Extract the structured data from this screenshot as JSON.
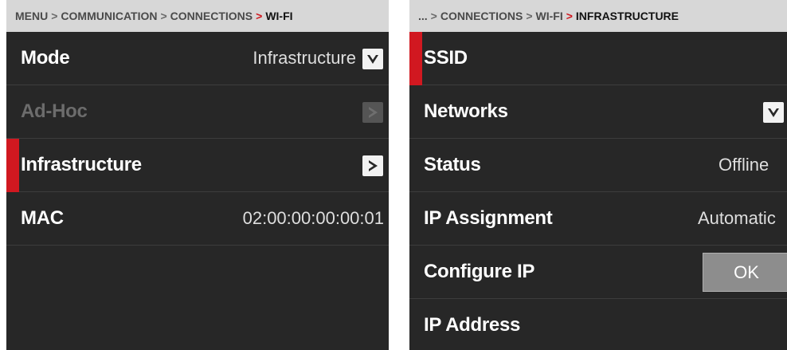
{
  "left_panel": {
    "breadcrumb": {
      "path": [
        "MENU",
        "COMMUNICATION",
        "CONNECTIONS"
      ],
      "current": "WI-FI"
    },
    "rows": {
      "mode": {
        "label": "Mode",
        "value": "Infrastructure",
        "icon": "chevron-down-icon"
      },
      "adhoc": {
        "label": "Ad-Hoc",
        "icon": "chevron-right-icon",
        "disabled": true
      },
      "infrastructure": {
        "label": "Infrastructure",
        "icon": "chevron-right-icon",
        "selected": true
      },
      "mac": {
        "label": "MAC",
        "value": "02:00:00:00:00:01"
      }
    }
  },
  "right_panel": {
    "breadcrumb": {
      "path": [
        "...",
        "CONNECTIONS",
        "WI-FI"
      ],
      "current": "INFRASTRUCTURE"
    },
    "rows": {
      "ssid": {
        "label": "SSID",
        "selected": true
      },
      "networks": {
        "label": "Networks",
        "icon": "chevron-down-icon"
      },
      "status": {
        "label": "Status",
        "value": "Offline"
      },
      "ip_assignment": {
        "label": "IP Assignment",
        "value": "Automatic"
      },
      "configure_ip": {
        "label": "Configure IP",
        "button": "OK"
      },
      "ip_address": {
        "label": "IP Address"
      }
    }
  },
  "colors": {
    "panel_bg": "#272727",
    "breadcrumb_bg": "#d7d7d7",
    "accent_red": "#d11820",
    "text": "#ffffff",
    "text_disabled": "#6c6c6c"
  }
}
